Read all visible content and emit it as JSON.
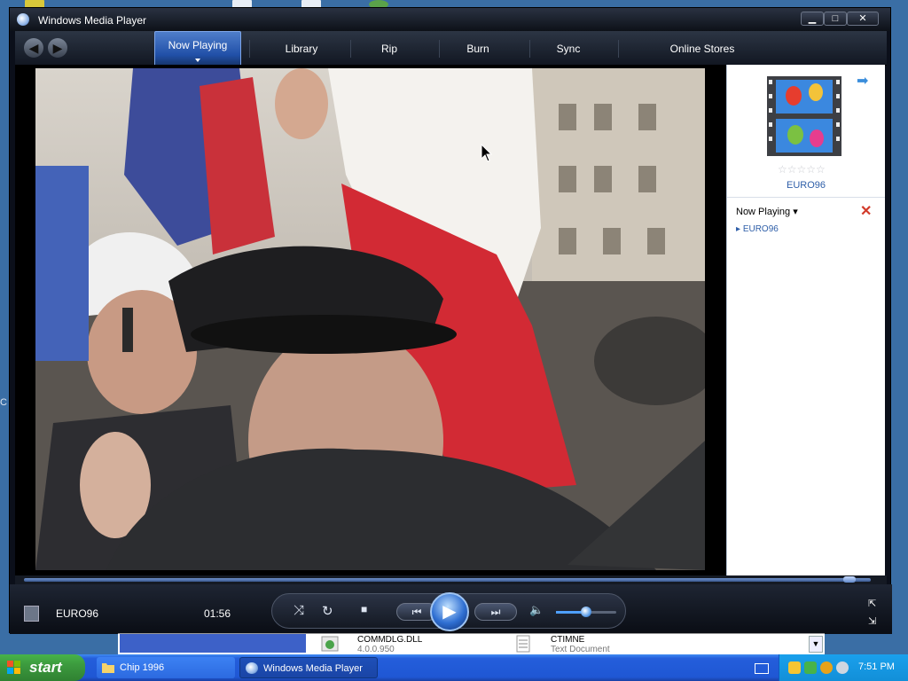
{
  "window": {
    "title": "Windows Media Player",
    "controls": {
      "minimize": "▁",
      "maximize": "□",
      "close": "✕"
    }
  },
  "nav": {
    "back": "◀",
    "forward": "▶",
    "tabs": [
      {
        "label": "Now Playing",
        "active": true
      },
      {
        "label": "Library"
      },
      {
        "label": "Rip"
      },
      {
        "label": "Burn"
      },
      {
        "label": "Sync"
      },
      {
        "label": "Online Stores"
      }
    ]
  },
  "video": {
    "description_icon": "video-frame"
  },
  "side_pane": {
    "arrow": "➡",
    "rating_stars": "☆☆☆☆☆",
    "album_title": "EURO96",
    "now_playing_dropdown": "Now Playing",
    "close": "✕",
    "playlist": [
      "EURO96"
    ]
  },
  "transport": {
    "clip_name": "EURO96",
    "time": "01:56",
    "shuffle": "⤨",
    "repeat": "↻",
    "stop": "■",
    "prev": "⏮",
    "play": "▶",
    "next": "⏭",
    "mute": "🔈",
    "volume_fraction": 0.5,
    "seek_fraction": 0.98
  },
  "explorer": {
    "file1_name": "COMMDLG.DLL",
    "file1_version": "4.0.0.950",
    "file2_name": "CTIMNE",
    "file2_type": "Text Document"
  },
  "taskbar": {
    "start": "start",
    "tasks": [
      {
        "label": "Chip 1996"
      },
      {
        "label": "Windows Media Player",
        "active": true
      }
    ],
    "clock": "7:51 PM"
  },
  "colors": {
    "accent": "#2150a8",
    "taskbar": "#245edb",
    "start": "#3c9a3e",
    "link": "#2e5ea8"
  }
}
